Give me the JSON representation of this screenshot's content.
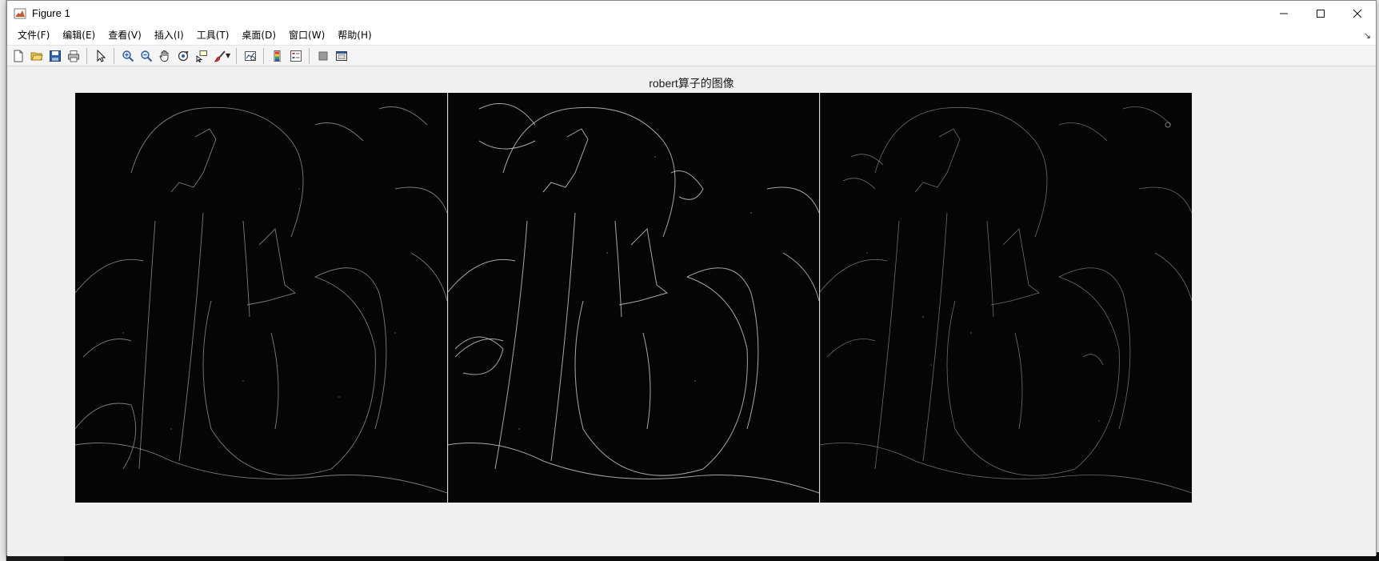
{
  "window": {
    "title": "Figure 1"
  },
  "menu": [
    {
      "label": "文件(F)"
    },
    {
      "label": "编辑(E)"
    },
    {
      "label": "查看(V)"
    },
    {
      "label": "插入(I)"
    },
    {
      "label": "工具(T)"
    },
    {
      "label": "桌面(D)"
    },
    {
      "label": "窗口(W)"
    },
    {
      "label": "帮助(H)"
    }
  ],
  "toolbar": {
    "icons": [
      "new-figure-icon",
      "open-file-icon",
      "save-icon",
      "print-icon",
      "edit-plot-arrow-icon",
      "zoom-in-icon",
      "zoom-out-icon",
      "pan-hand-icon",
      "rotate-3d-icon",
      "data-cursor-icon",
      "brush-icon",
      "link-plot-icon",
      "colorbar-icon",
      "legend-icon",
      "hide-plot-tools-icon",
      "show-plot-tools-icon"
    ]
  },
  "figure": {
    "title": "robert算子的图像",
    "panels": 3,
    "background_color": "#050505",
    "edge_color": "#cfcfcf"
  }
}
